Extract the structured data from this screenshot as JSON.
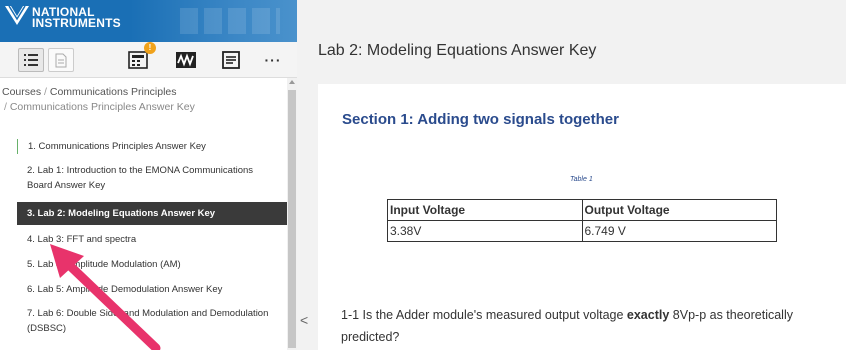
{
  "brand": {
    "logo_text_line1": "NATIONAL",
    "logo_text_line2": "INSTRUMENTS",
    "primary_color": "#1a6fb5"
  },
  "toolbar": {
    "items": [
      {
        "icon": "table-of-contents-icon"
      },
      {
        "icon": "document-icon"
      },
      {
        "icon": "calculator-notification-icon",
        "badge": "!"
      },
      {
        "icon": "waveform-icon"
      },
      {
        "icon": "notes-icon"
      },
      {
        "icon": "more-options-icon",
        "label": "···"
      }
    ]
  },
  "breadcrumb": {
    "root": "Courses",
    "separator": "/",
    "current": "Communications Principles",
    "sub": "Communications Principles Answer Key"
  },
  "nav": {
    "items": [
      {
        "label": "1. Communications Principles Answer Key"
      },
      {
        "label_line1": "2. Lab 1: Introduction to the EMONA Communications",
        "label_line2": "Board Answer Key"
      },
      {
        "label": "3. Lab 2: Modeling Equations Answer Key",
        "active": true
      },
      {
        "label": "4. Lab 3: FFT and spectra"
      },
      {
        "label": "5. Lab 4: Amplitude Modulation (AM)"
      },
      {
        "label": "6. Lab 5: Amplitude Demodulation Answer Key"
      },
      {
        "label_line1": "7. Lab 6: Double Sideband Modulation and Demodulation",
        "label_line2": "(DSBSC)"
      }
    ]
  },
  "main": {
    "page_title": "Lab 2: Modeling Equations Answer Key",
    "collapse_glyph": "<",
    "section_title": "Section 1: Adding two signals together",
    "table_caption": "Table 1",
    "table": {
      "headers": [
        "Input Voltage",
        "Output Voltage"
      ],
      "rows": [
        [
          "3.38V",
          "6.749 V"
        ]
      ]
    },
    "question": {
      "prefix": "1-1 Is the Adder module's measured output voltage ",
      "emphasis": "exactly",
      "suffix": " 8Vp-p as theoretically predicted?"
    }
  },
  "annotation": {
    "arrow_color": "#e8336b"
  }
}
